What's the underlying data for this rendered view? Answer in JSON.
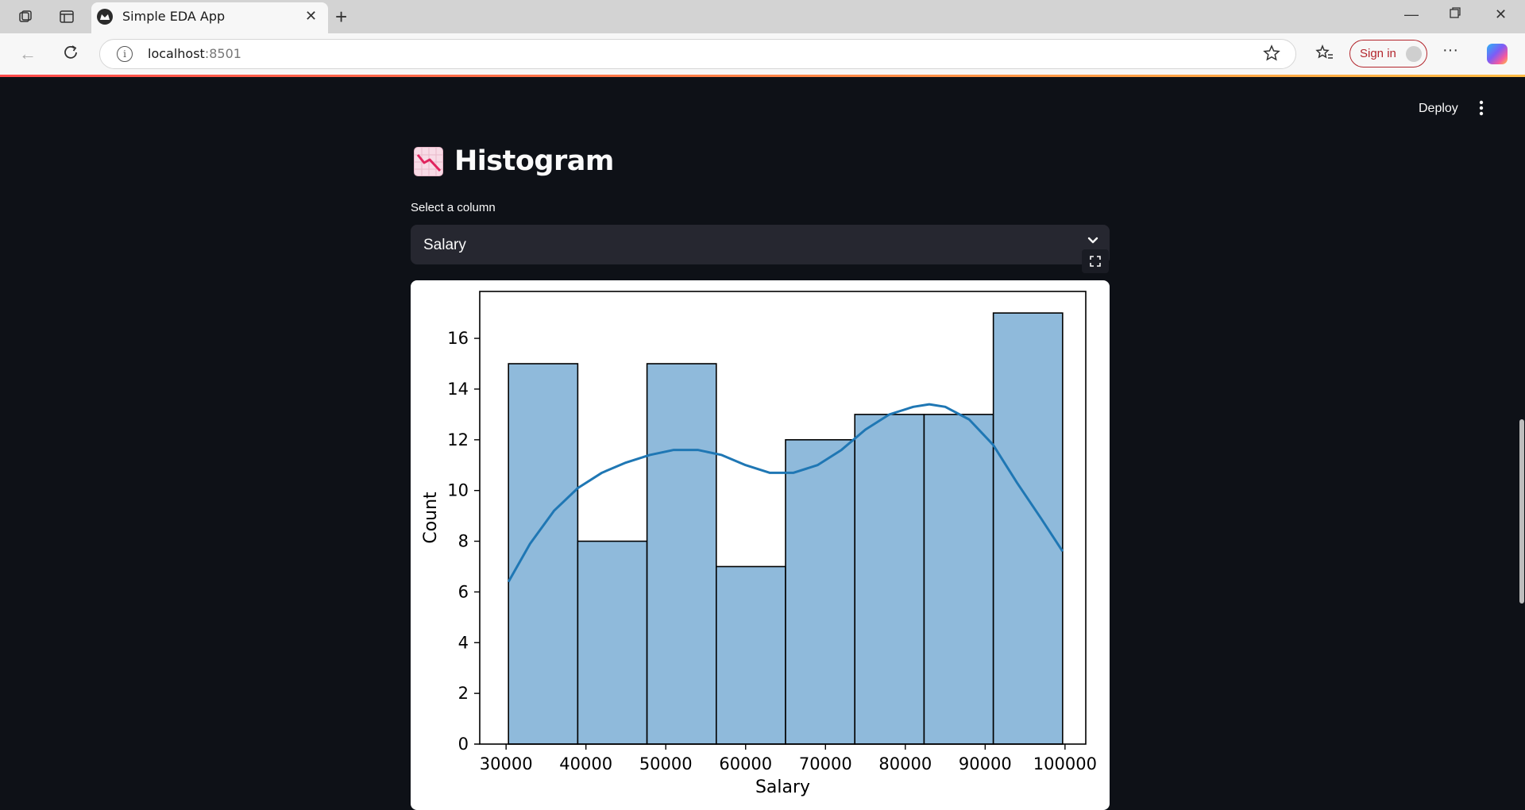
{
  "browser": {
    "tab_title": "Simple EDA App",
    "address_host": "localhost",
    "address_port": ":8501",
    "sign_in_label": "Sign in"
  },
  "app_header": {
    "deploy_label": "Deploy"
  },
  "main": {
    "title": "Histogram",
    "select_label": "Select a column",
    "select_value": "Salary"
  },
  "colors": {
    "page_bg": "#0e1117",
    "bar_fill": "#8fbadb",
    "kde_line": "#1f77b4"
  },
  "chart_data": {
    "type": "bar",
    "title": "",
    "xlabel": "Salary",
    "ylabel": "Count",
    "bin_edges": [
      30300,
      38975,
      47650,
      56325,
      65000,
      73675,
      82350,
      91025,
      99700
    ],
    "values": [
      15,
      8,
      15,
      7,
      12,
      13,
      13,
      17
    ],
    "xticks": [
      30000,
      40000,
      50000,
      60000,
      70000,
      80000,
      90000,
      100000
    ],
    "yticks": [
      0,
      2,
      4,
      6,
      8,
      10,
      12,
      14,
      16
    ],
    "xlim": [
      26700,
      102600
    ],
    "ylim": [
      0,
      17.85
    ],
    "grid": false,
    "kde": {
      "x": [
        30300,
        33000,
        36000,
        39000,
        42000,
        45000,
        48000,
        51000,
        54000,
        57000,
        60000,
        63000,
        66000,
        69000,
        72000,
        75000,
        78000,
        81000,
        83000,
        85000,
        88000,
        91000,
        94000,
        97000,
        99700
      ],
      "y": [
        6.4,
        7.9,
        9.2,
        10.1,
        10.7,
        11.1,
        11.4,
        11.6,
        11.6,
        11.4,
        11.0,
        10.7,
        10.7,
        11.0,
        11.6,
        12.4,
        13.0,
        13.3,
        13.4,
        13.3,
        12.8,
        11.8,
        10.3,
        8.9,
        7.6
      ]
    }
  }
}
